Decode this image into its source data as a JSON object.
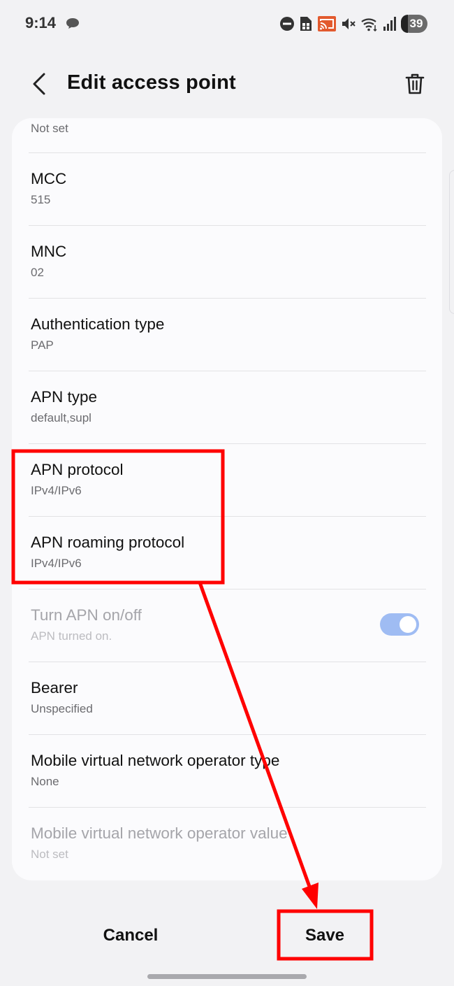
{
  "status_bar": {
    "time": "9:14",
    "battery": "39",
    "icons": [
      "chat-bubble-icon",
      "do-not-disturb-icon",
      "sim-icon",
      "cast-icon",
      "mute-icon",
      "wifi-icon",
      "signal-icon",
      "battery-icon"
    ]
  },
  "app_bar": {
    "title": "Edit access point",
    "back_icon": "chevron-left-icon",
    "delete_icon": "trash-icon"
  },
  "list": {
    "first_item_sub": "Not set",
    "items": [
      {
        "title": "MCC",
        "value": "515"
      },
      {
        "title": "MNC",
        "value": "02"
      },
      {
        "title": "Authentication type",
        "value": "PAP"
      },
      {
        "title": "APN type",
        "value": "default,supl"
      },
      {
        "title": "APN protocol",
        "value": "IPv4/IPv6"
      },
      {
        "title": "APN roaming protocol",
        "value": "IPv4/IPv6"
      },
      {
        "title": "Turn APN on/off",
        "value": "APN turned on.",
        "toggle_on": true,
        "disabled": true
      },
      {
        "title": "Bearer",
        "value": "Unspecified"
      },
      {
        "title": "Mobile virtual network operator type",
        "value": "None"
      },
      {
        "title": "Mobile virtual network operator value",
        "value": "Not set",
        "disabled": true
      }
    ]
  },
  "footer": {
    "cancel_label": "Cancel",
    "save_label": "Save"
  },
  "colors": {
    "background": "#f2f2f4",
    "card": "#fbfbfd",
    "toggle_on": "#9fbcf3",
    "annotation_red": "#ff0000"
  }
}
